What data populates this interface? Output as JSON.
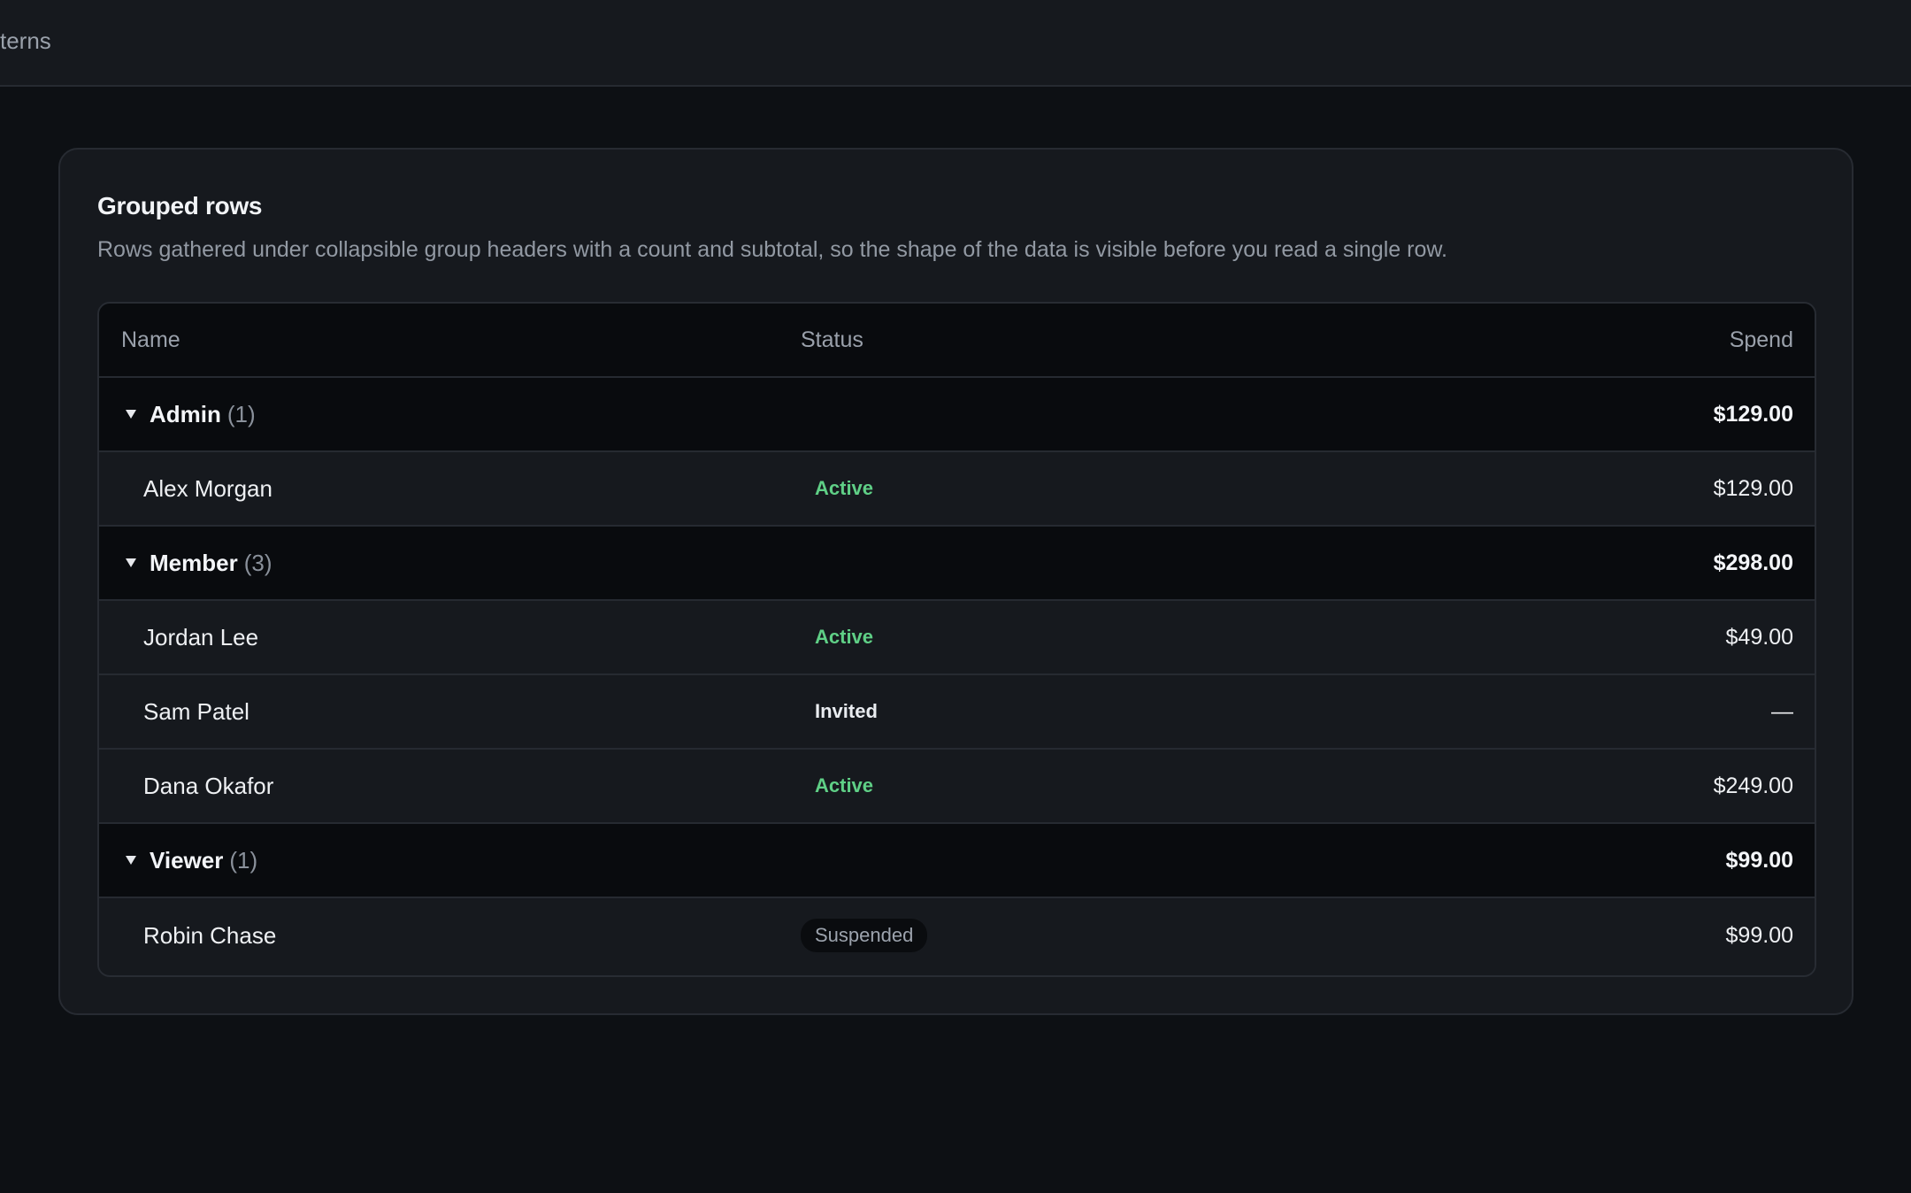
{
  "topbar": {
    "crumb": "terns"
  },
  "card": {
    "title": "Grouped rows",
    "description": "Rows gathered under collapsible group headers with a count and subtotal, so the shape of the data is visible before you read a single row."
  },
  "table": {
    "columns": {
      "name": "Name",
      "status": "Status",
      "spend": "Spend"
    },
    "groups": [
      {
        "label": "Admin",
        "count": "(1)",
        "subtotal": "$129.00",
        "rows": [
          {
            "name": "Alex Morgan",
            "status": "Active",
            "spend": "$129.00"
          }
        ]
      },
      {
        "label": "Member",
        "count": "(3)",
        "subtotal": "$298.00",
        "rows": [
          {
            "name": "Jordan Lee",
            "status": "Active",
            "spend": "$49.00"
          },
          {
            "name": "Sam Patel",
            "status": "Invited",
            "spend": "—"
          },
          {
            "name": "Dana Okafor",
            "status": "Active",
            "spend": "$249.00"
          }
        ]
      },
      {
        "label": "Viewer",
        "count": "(1)",
        "subtotal": "$99.00",
        "rows": [
          {
            "name": "Robin Chase",
            "status": "Suspended",
            "spend": "$99.00"
          }
        ]
      }
    ]
  },
  "colors": {
    "background": "#0d1014",
    "card": "#16191e",
    "group_row": "#090b0e",
    "status_active": "#5fcf86",
    "status_invited": "#e9ecf0",
    "status_suspended": "#9ca3ad"
  },
  "icons": {
    "group_toggle": "caret-down-icon"
  }
}
